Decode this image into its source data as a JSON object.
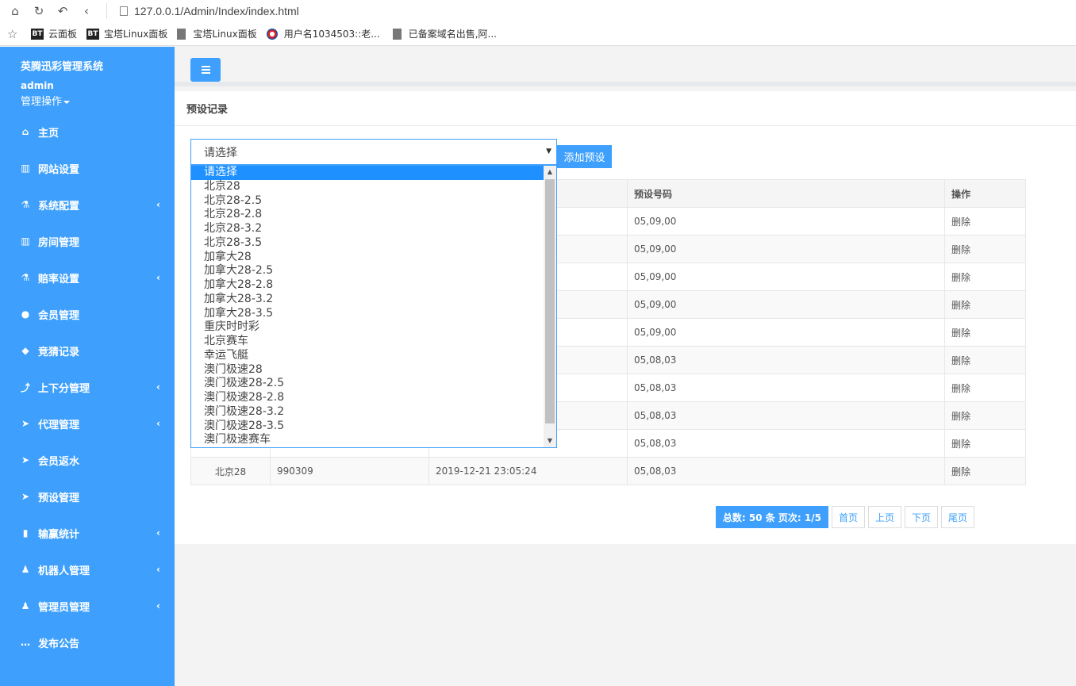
{
  "browser": {
    "url": "127.0.0.1/Admin/Index/index.html",
    "bookmarks": [
      "云面板",
      "宝塔Linux面板",
      "宝塔Linux面板",
      "用户名1034503::老...",
      "已备案域名出售,阿..."
    ]
  },
  "sidebar": {
    "title": "英腾迅彩管理系统",
    "user": "admin",
    "ops": "管理操作",
    "items": [
      {
        "label": "主页",
        "icon": "home-icon",
        "arrow": false
      },
      {
        "label": "网站设置",
        "icon": "columns-icon",
        "arrow": false
      },
      {
        "label": "系统配置",
        "icon": "flask-icon",
        "arrow": true
      },
      {
        "label": "房间管理",
        "icon": "columns-icon",
        "arrow": false
      },
      {
        "label": "赔率设置",
        "icon": "flask-icon",
        "arrow": true
      },
      {
        "label": "会员管理",
        "icon": "user-icon",
        "arrow": false
      },
      {
        "label": "竞猜记录",
        "icon": "car-icon",
        "arrow": false
      },
      {
        "label": "上下分管理",
        "icon": "level-up-icon",
        "arrow": true
      },
      {
        "label": "代理管理",
        "icon": "paper-plane-icon",
        "arrow": true
      },
      {
        "label": "会员返水",
        "icon": "paper-plane-icon",
        "arrow": false
      },
      {
        "label": "预设管理",
        "icon": "paper-plane-icon",
        "arrow": false
      },
      {
        "label": "输赢统计",
        "icon": "bar-chart-icon",
        "arrow": true
      },
      {
        "label": "机器人管理",
        "icon": "male-icon",
        "arrow": true
      },
      {
        "label": "管理员管理",
        "icon": "male-icon",
        "arrow": true
      },
      {
        "label": "发布公告",
        "icon": "comment-icon",
        "arrow": false
      }
    ]
  },
  "main": {
    "panel_title": "预设记录",
    "select_value": "请选择",
    "add_button": "添加预设",
    "columns": [
      "",
      "",
      "",
      "预设号码",
      "操作"
    ],
    "rows": [
      [
        "",
        "",
        "",
        "05,09,00",
        "删除"
      ],
      [
        "",
        "",
        "",
        "05,09,00",
        "删除"
      ],
      [
        "",
        "",
        "",
        "05,09,00",
        "删除"
      ],
      [
        "",
        "",
        "",
        "05,09,00",
        "删除"
      ],
      [
        "",
        "",
        "",
        "05,09,00",
        "删除"
      ],
      [
        "",
        "",
        "",
        "05,08,03",
        "删除"
      ],
      [
        "",
        "",
        "",
        "05,08,03",
        "删除"
      ],
      [
        "",
        "",
        "",
        "05,08,03",
        "删除"
      ],
      [
        "",
        "",
        "",
        "05,08,03",
        "删除"
      ],
      [
        "北京28",
        "990309",
        "2019-12-21 23:05:24",
        "05,08,03",
        "删除"
      ]
    ],
    "pager": {
      "total": "总数: 50 条 页次: 1/5",
      "first": "首页",
      "prev": "上页",
      "next": "下页",
      "last": "尾页"
    },
    "dropdown_options": [
      "请选择",
      "北京28",
      "北京28-2.5",
      "北京28-2.8",
      "北京28-3.2",
      "北京28-3.5",
      "加拿大28",
      "加拿大28-2.5",
      "加拿大28-2.8",
      "加拿大28-3.2",
      "加拿大28-3.5",
      "重庆时时彩",
      "北京赛车",
      "幸运飞艇",
      "澳门极速28",
      "澳门极速28-2.5",
      "澳门极速28-2.8",
      "澳门极速28-3.2",
      "澳门极速28-3.5",
      "澳门极速赛车"
    ],
    "dropdown_selected": 0
  }
}
